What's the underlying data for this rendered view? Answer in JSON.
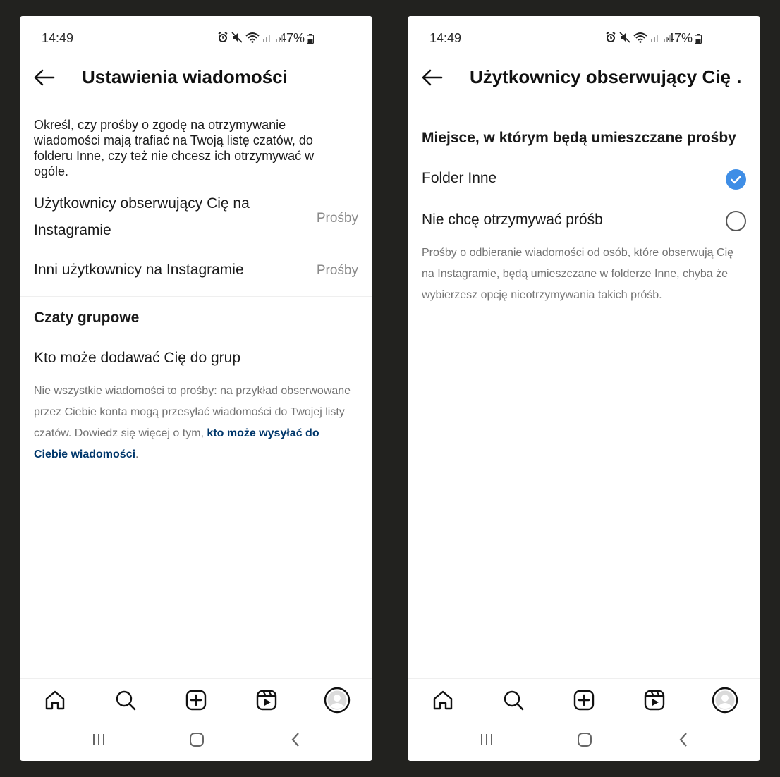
{
  "left": {
    "status": {
      "time": "14:49",
      "battery": "47%"
    },
    "header": {
      "title": "Ustawienia wiadomości"
    },
    "intro": "Określ, czy prośby o zgodę na otrzymywanie wiadomości mają trafiać na Twoją listę czatów, do folderu Inne, czy też nie chcesz ich otrzymywać w ogóle.",
    "settings": [
      {
        "label_line1": "Użytkownicy obserwujący Cię na",
        "label_line2": "Instagramie",
        "value": "Prośby"
      },
      {
        "label": "Inni użytkownicy na Instagramie",
        "value": "Prośby"
      }
    ],
    "group_section": {
      "title": "Czaty grupowe",
      "item": "Kto może dodawać Cię do grup"
    },
    "footnote": {
      "text": "Nie wszystkie wiadomości to prośby: na przykład obserwowane przez Ciebie konta mogą przesyłać wiadomości do Twojej listy czatów. Dowiedz się więcej o tym, ",
      "link": "kto może wysyłać do Ciebie wiadomości",
      "end": "."
    }
  },
  "right": {
    "status": {
      "time": "14:49",
      "battery": "47%"
    },
    "header": {
      "title": "Użytkownicy obserwujący Cię …"
    },
    "section_title": "Miejsce, w którym będą umieszczane prośby",
    "options": [
      {
        "label": "Folder Inne",
        "selected": true
      },
      {
        "label": "Nie chcę otrzymywać próśb",
        "selected": false
      }
    ],
    "description": "Prośby o odbieranie wiadomości od osób, które obserwują Cię na Instagramie, będą umieszczane w folderze Inne, chyba że wybierzesz opcję nieotrzymywania takich próśb."
  },
  "nav": {
    "items": [
      "home-icon",
      "search-icon",
      "create-icon",
      "reels-icon",
      "profile-avatar"
    ]
  },
  "colors": {
    "accent": "#3f8ee6",
    "link": "#00376b",
    "secondary_text": "#737373",
    "background": "#22221f"
  }
}
